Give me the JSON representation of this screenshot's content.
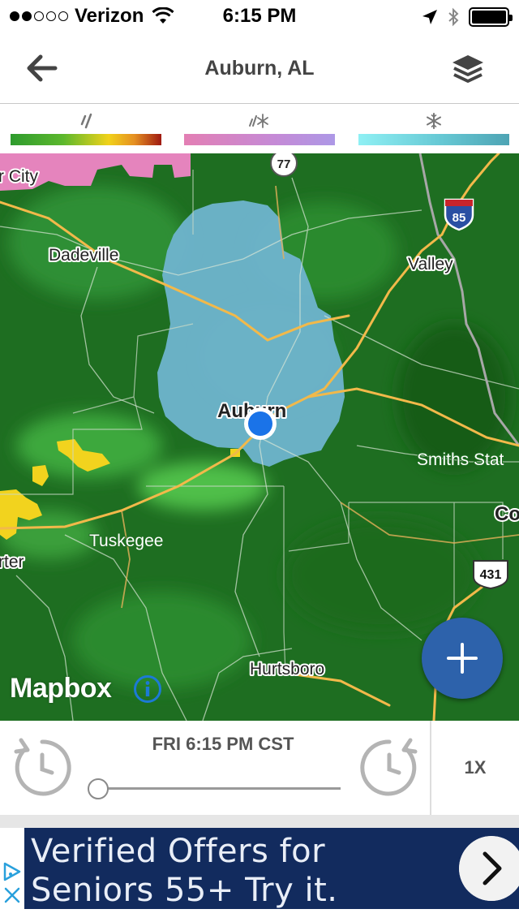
{
  "status_bar": {
    "carrier": "Verizon",
    "time": "6:15 PM",
    "signal_dots_filled": 2,
    "signal_dots_total": 5
  },
  "nav": {
    "title": "Auburn, AL",
    "back_icon": "arrow-left-icon",
    "layers_icon": "layers-icon"
  },
  "legend": {
    "rain_icon": "rain-icon",
    "mix_icon": "mixed-precip-icon",
    "snow_icon": "snowflake-icon",
    "colors": {
      "rain": [
        "#2e9b2e",
        "#f1d21a",
        "#9f1a12"
      ],
      "mix": [
        "#e37fb4",
        "#ad98e6"
      ],
      "snow": [
        "#8ff0f4",
        "#4ea4b4"
      ]
    }
  },
  "map": {
    "place_labels": {
      "city": "r City",
      "dadeville": "Dadeville",
      "valley": "Valley",
      "auburn": "Auburn",
      "smiths_station": "Smiths Stat",
      "columbus": "Co",
      "tuskegee": "Tuskegee",
      "porter": "rter",
      "hurtsboro": "Hurtsboro"
    },
    "shields": {
      "route_77": "77",
      "interstate_85": "85",
      "us_431": "431"
    },
    "attribution": "Mapbox",
    "zoom_in_label": "+",
    "colors": {
      "radar_green": "#1c6b1f",
      "snow_blue": "#6fb4cf",
      "roads": "#f0b84a",
      "user_location": "#1a73e8",
      "fab": "#2d62ab"
    }
  },
  "playback": {
    "timestamp": "FRI 6:15 PM CST",
    "speed": "1X",
    "progress": 0
  },
  "ad": {
    "line1": "Verified Offers for",
    "line2": "Seniors 55+ Try it.",
    "cta_icon": "chevron-right-icon",
    "close_icon": "close-icon",
    "adchoices_icon": "adchoices-icon"
  }
}
